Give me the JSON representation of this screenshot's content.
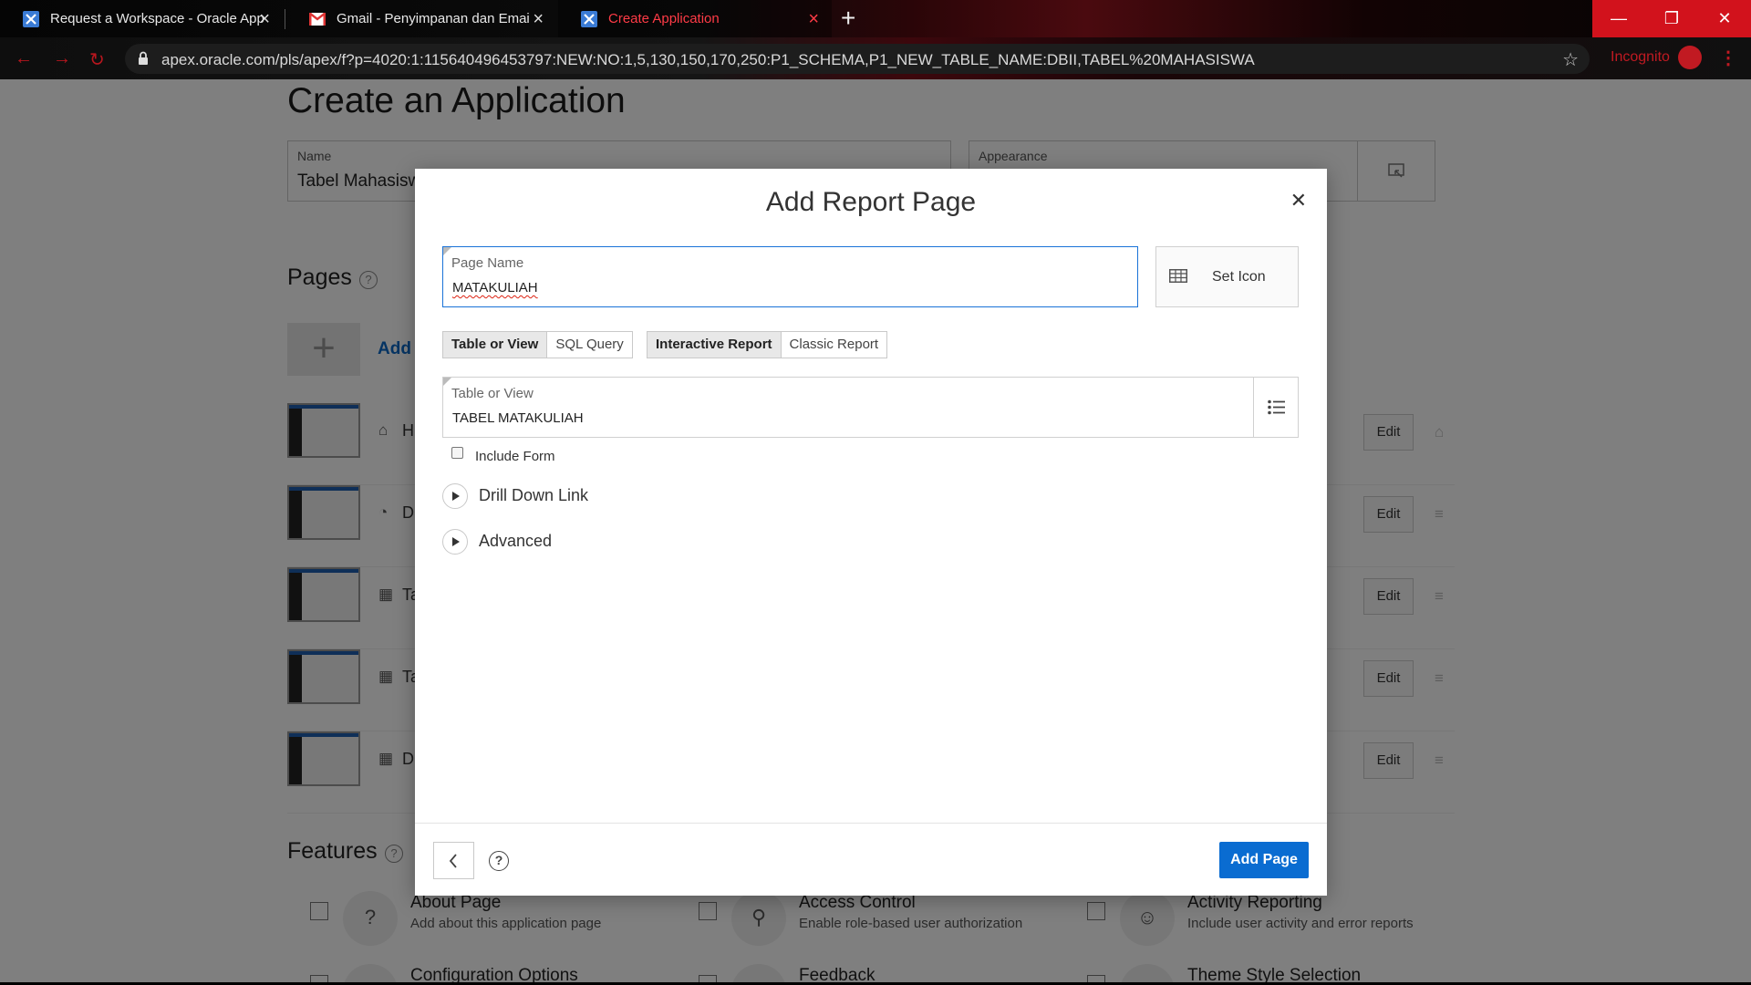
{
  "browser": {
    "tabs": [
      {
        "title": "Request a Workspace - Oracle Application Express",
        "icon": "apex-icon"
      },
      {
        "title": "Gmail - Penyimpanan dan Email Gratis",
        "icon": "gmail-icon"
      },
      {
        "title": "Create Application",
        "icon": "apex-icon",
        "active": true
      }
    ],
    "url": "apex.oracle.com/pls/apex/f?p=4020:1:115640496453797:NEW:NO:1,5,130,150,170,250:P1_SCHEMA,P1_NEW_TABLE_NAME:DBII,TABEL%20MAHASISWA",
    "incognito_label": "Incognito"
  },
  "page": {
    "title": "Create an Application",
    "name_label": "Name",
    "name_value": "Tabel Mahasisw",
    "appearance_label": "Appearance",
    "pages_title": "Pages",
    "add_label": "Add",
    "rows": [
      {
        "text": "H",
        "icon": "home-icon",
        "edit": "Edit"
      },
      {
        "text": "D",
        "icon": "dashboard-icon",
        "edit": "Edit"
      },
      {
        "text": "Ta",
        "icon": "table-search-icon",
        "edit": "Edit"
      },
      {
        "text": "Ta",
        "icon": "table-icon",
        "edit": "Edit"
      },
      {
        "text": "D",
        "icon": "table-icon",
        "edit": "Edit"
      }
    ],
    "features_title": "Features",
    "features": [
      {
        "title": "About Page",
        "desc": "Add about this application page",
        "icon": "question-icon"
      },
      {
        "title": "Access Control",
        "desc": "Enable role-based user authorization",
        "icon": "key-icon"
      },
      {
        "title": "Activity Reporting",
        "desc": "Include user activity and error reports",
        "icon": "user-chart-icon"
      },
      {
        "title": "Configuration Options",
        "icon": "config-icon"
      },
      {
        "title": "Feedback",
        "icon": "feedback-icon"
      },
      {
        "title": "Theme Style Selection",
        "icon": "theme-icon"
      }
    ]
  },
  "dialog": {
    "title": "Add Report Page",
    "page_name_label": "Page Name",
    "page_name_value": "MATAKULIAH",
    "set_icon_label": "Set Icon",
    "source_options": [
      "Table or View",
      "SQL Query"
    ],
    "source_selected": "Table or View",
    "report_options": [
      "Interactive Report",
      "Classic Report"
    ],
    "report_selected": "Interactive Report",
    "table_label": "Table or View",
    "table_value": "TABEL MATAKULIAH",
    "include_form_label": "Include Form",
    "include_form_checked": false,
    "drill_down_label": "Drill Down Link",
    "advanced_label": "Advanced",
    "add_page_label": "Add Page"
  },
  "colors": {
    "accent": "#0a6cd1",
    "window_close": "#d2121c",
    "active_tab_text": "#ff3b46"
  }
}
